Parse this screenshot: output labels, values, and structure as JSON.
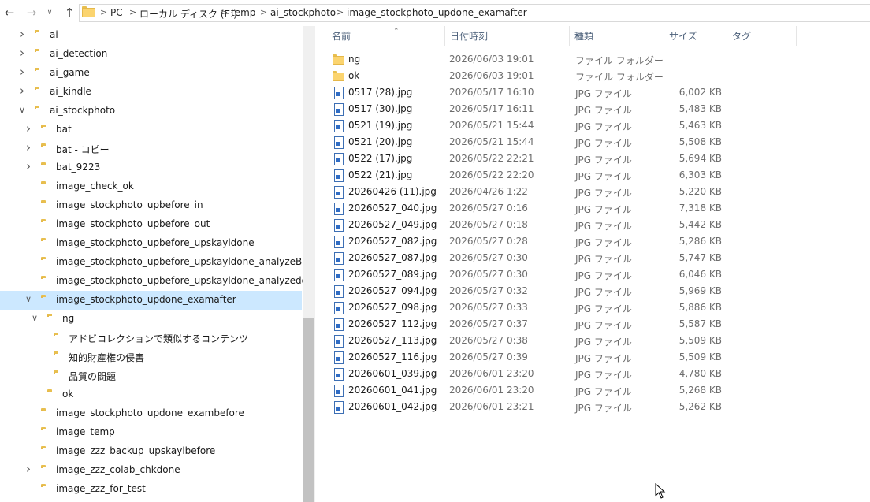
{
  "address_bar": {
    "back_icon": "arrow-left-icon",
    "forward_icon": "arrow-right-icon",
    "recent_icon": "chevron-down-icon",
    "up_icon": "arrow-up-icon",
    "crumbs": [
      "PC",
      "ローカル ディスク (E:)",
      "temp",
      "ai_stockphoto",
      "image_stockphoto_updone_examafter"
    ]
  },
  "tree": {
    "items": [
      {
        "label": "ai",
        "level": 0,
        "chevron": ">"
      },
      {
        "label": "ai_detection",
        "level": 0,
        "chevron": ">"
      },
      {
        "label": "ai_game",
        "level": 0,
        "chevron": ">"
      },
      {
        "label": "ai_kindle",
        "level": 0,
        "chevron": ">"
      },
      {
        "label": "ai_stockphoto",
        "level": 0,
        "chevron": "v"
      },
      {
        "label": "bat",
        "level": 1,
        "chevron": ">"
      },
      {
        "label": "bat - コピー",
        "level": 1,
        "chevron": ">"
      },
      {
        "label": "bat_9223",
        "level": 1,
        "chevron": ">"
      },
      {
        "label": "image_check_ok",
        "level": 1,
        "chevron": ""
      },
      {
        "label": "image_stockphoto_upbefore_in",
        "level": 1,
        "chevron": ""
      },
      {
        "label": "image_stockphoto_upbefore_out",
        "level": 1,
        "chevron": ""
      },
      {
        "label": "image_stockphoto_upbefore_upskayldone",
        "level": 1,
        "chevron": ""
      },
      {
        "label": "image_stockphoto_upbefore_upskayldone_analyzeBefore",
        "level": 1,
        "chevron": ""
      },
      {
        "label": "image_stockphoto_upbefore_upskayldone_analyzedone",
        "level": 1,
        "chevron": ""
      },
      {
        "label": "image_stockphoto_updone_examafter",
        "level": 1,
        "chevron": "v",
        "selected": true
      },
      {
        "label": "ng",
        "level": 2,
        "chevron": "v"
      },
      {
        "label": "アドビコレクションで類似するコンテンツ",
        "level": 3,
        "chevron": ""
      },
      {
        "label": "知的財産権の侵害",
        "level": 3,
        "chevron": ""
      },
      {
        "label": "品質の問題",
        "level": 3,
        "chevron": ""
      },
      {
        "label": "ok",
        "level": 2,
        "chevron": ""
      },
      {
        "label": "image_stockphoto_updone_exambefore",
        "level": 1,
        "chevron": ""
      },
      {
        "label": "image_temp",
        "level": 1,
        "chevron": ""
      },
      {
        "label": "image_zzz_backup_upskaylbefore",
        "level": 1,
        "chevron": ""
      },
      {
        "label": "image_zzz_colab_chkdone",
        "level": 1,
        "chevron": ">"
      },
      {
        "label": "image_zzz_for_test",
        "level": 1,
        "chevron": ""
      }
    ]
  },
  "columns": {
    "name": "名前",
    "date": "日付時刻",
    "type": "種類",
    "size": "サイズ",
    "tag": "タグ"
  },
  "files": [
    {
      "name": "ng",
      "date": "2026/06/03 19:01",
      "type": "ファイル フォルダー",
      "size": "",
      "kind": "folder"
    },
    {
      "name": "ok",
      "date": "2026/06/03 19:01",
      "type": "ファイル フォルダー",
      "size": "",
      "kind": "folder"
    },
    {
      "name": "0517 (28).jpg",
      "date": "2026/05/17 16:10",
      "type": "JPG ファイル",
      "size": "6,002 KB",
      "kind": "jpg"
    },
    {
      "name": "0517 (30).jpg",
      "date": "2026/05/17 16:11",
      "type": "JPG ファイル",
      "size": "5,483 KB",
      "kind": "jpg"
    },
    {
      "name": "0521 (19).jpg",
      "date": "2026/05/21 15:44",
      "type": "JPG ファイル",
      "size": "5,463 KB",
      "kind": "jpg"
    },
    {
      "name": "0521 (20).jpg",
      "date": "2026/05/21 15:44",
      "type": "JPG ファイル",
      "size": "5,508 KB",
      "kind": "jpg"
    },
    {
      "name": "0522 (17).jpg",
      "date": "2026/05/22 22:21",
      "type": "JPG ファイル",
      "size": "5,694 KB",
      "kind": "jpg"
    },
    {
      "name": "0522 (21).jpg",
      "date": "2026/05/22 22:20",
      "type": "JPG ファイル",
      "size": "6,303 KB",
      "kind": "jpg"
    },
    {
      "name": "20260426 (11).jpg",
      "date": "2026/04/26 1:22",
      "type": "JPG ファイル",
      "size": "5,220 KB",
      "kind": "jpg"
    },
    {
      "name": "20260527_040.jpg",
      "date": "2026/05/27 0:16",
      "type": "JPG ファイル",
      "size": "7,318 KB",
      "kind": "jpg"
    },
    {
      "name": "20260527_049.jpg",
      "date": "2026/05/27 0:18",
      "type": "JPG ファイル",
      "size": "5,442 KB",
      "kind": "jpg"
    },
    {
      "name": "20260527_082.jpg",
      "date": "2026/05/27 0:28",
      "type": "JPG ファイル",
      "size": "5,286 KB",
      "kind": "jpg"
    },
    {
      "name": "20260527_087.jpg",
      "date": "2026/05/27 0:30",
      "type": "JPG ファイル",
      "size": "5,747 KB",
      "kind": "jpg"
    },
    {
      "name": "20260527_089.jpg",
      "date": "2026/05/27 0:30",
      "type": "JPG ファイル",
      "size": "6,046 KB",
      "kind": "jpg"
    },
    {
      "name": "20260527_094.jpg",
      "date": "2026/05/27 0:32",
      "type": "JPG ファイル",
      "size": "5,969 KB",
      "kind": "jpg"
    },
    {
      "name": "20260527_098.jpg",
      "date": "2026/05/27 0:33",
      "type": "JPG ファイル",
      "size": "5,886 KB",
      "kind": "jpg"
    },
    {
      "name": "20260527_112.jpg",
      "date": "2026/05/27 0:37",
      "type": "JPG ファイル",
      "size": "5,587 KB",
      "kind": "jpg"
    },
    {
      "name": "20260527_113.jpg",
      "date": "2026/05/27 0:38",
      "type": "JPG ファイル",
      "size": "5,509 KB",
      "kind": "jpg"
    },
    {
      "name": "20260527_116.jpg",
      "date": "2026/05/27 0:39",
      "type": "JPG ファイル",
      "size": "5,509 KB",
      "kind": "jpg"
    },
    {
      "name": "20260601_039.jpg",
      "date": "2026/06/01 23:20",
      "type": "JPG ファイル",
      "size": "4,780 KB",
      "kind": "jpg"
    },
    {
      "name": "20260601_041.jpg",
      "date": "2026/06/01 23:20",
      "type": "JPG ファイル",
      "size": "5,268 KB",
      "kind": "jpg"
    },
    {
      "name": "20260601_042.jpg",
      "date": "2026/06/01 23:21",
      "type": "JPG ファイル",
      "size": "5,262 KB",
      "kind": "jpg"
    }
  ],
  "colors": {
    "selection": "#cce8ff",
    "folder": "#fbd46f",
    "header_text": "#4c607a"
  }
}
